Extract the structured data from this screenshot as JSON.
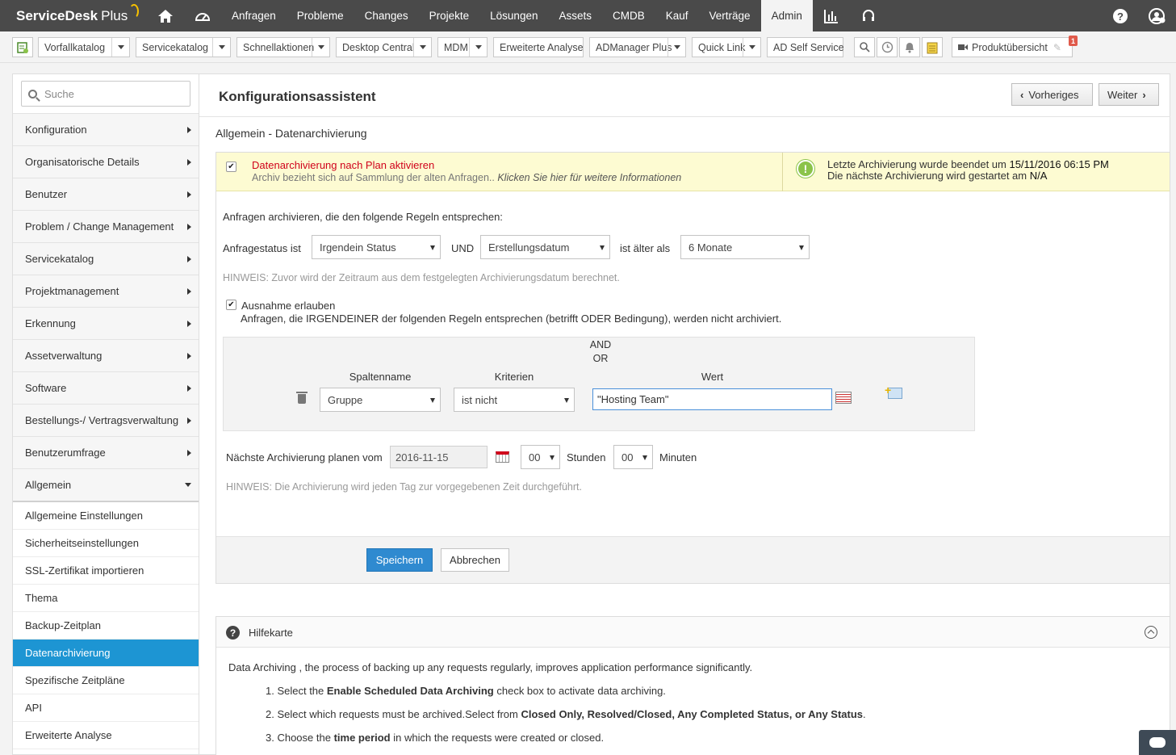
{
  "app": {
    "name": "ServiceDesk",
    "plus": "Plus"
  },
  "nav": {
    "items": [
      "Anfragen",
      "Probleme",
      "Changes",
      "Projekte",
      "Lösungen",
      "Assets",
      "CMDB",
      "Kauf",
      "Verträge",
      "Admin"
    ],
    "active": "Admin"
  },
  "toolbar": {
    "items": [
      "Vorfallkatalog",
      "Servicekatalog",
      "Schnellaktionen",
      "Desktop Central",
      "MDM",
      "Erweiterte Analyse",
      "ADManager Plus",
      "Quick Link",
      "AD Self Service"
    ],
    "product_overview": "Produktübersicht",
    "badge_count": "1"
  },
  "sidebar": {
    "search_placeholder": "Suche",
    "menu": [
      "Konfiguration",
      "Organisatorische Details",
      "Benutzer",
      "Problem / Change Management",
      "Servicekatalog",
      "Projektmanagement",
      "Erkennung",
      "Assetverwaltung",
      "Software",
      "Bestellungs-/ Vertragsverwaltung",
      "Benutzerumfrage",
      "Allgemein"
    ],
    "submenu": [
      "Allgemeine Einstellungen",
      "Sicherheitseinstellungen",
      "SSL-Zertifikat importieren",
      "Thema",
      "Backup-Zeitplan",
      "Datenarchivierung",
      "Spezifische Zeitpläne",
      "API",
      "Erweiterte Analyse"
    ],
    "active_sub": "Datenarchivierung"
  },
  "main": {
    "title": "Konfigurationsassistent",
    "prev_label": "Vorheriges",
    "next_label": "Weiter",
    "section_title": "Allgemein - Datenarchivierung",
    "enable_label": "Datenarchivierung nach Plan aktivieren",
    "enable_sub": "Archiv bezieht sich auf Sammlung der alten Anfragen.. ",
    "enable_sub_link": "Klicken Sie hier für weitere Informationen",
    "last_archive_prefix": "Letzte Archivierung wurde beendet um ",
    "last_archive_value": "15/11/2016 06:15 PM",
    "next_archive_prefix": "Die nächste Archivierung wird gestartet am ",
    "next_archive_value": "N/A",
    "rules_intro": "Anfragen archivieren, die den folgende Regeln entsprechen:",
    "status_label": "Anfragestatus ist",
    "status_value": "Irgendein Status",
    "und_label": "UND",
    "date_field_value": "Erstellungsdatum",
    "older_label": "ist älter als",
    "age_value": "6 Monate",
    "note1": "HINWEIS: Zuvor wird der Zeitraum aus dem festgelegten Archivierungsdatum berechnet.",
    "exception_label": "Ausnahme erlauben",
    "exception_sub": "Anfragen, die IRGENDEINER der folgenden Regeln entsprechen (betrifft ODER Bedingung), werden nicht archiviert.",
    "and_label": "AND",
    "or_label": "OR",
    "col_column": "Spaltenname",
    "col_criteria": "Kriterien",
    "col_value": "Wert",
    "rule_column": "Gruppe",
    "rule_criteria": "ist nicht",
    "rule_value": "\"Hosting Team\"",
    "schedule_label": "Nächste Archivierung planen vom",
    "schedule_date": "2016-11-15",
    "hours_value": "00",
    "hours_label": "Stunden",
    "minutes_value": "00",
    "minutes_label": "Minuten",
    "note2": "HINWEIS: Die Archivierung wird jeden Tag zur vorgegebenen Zeit durchgeführt.",
    "save_label": "Speichern",
    "cancel_label": "Abbrechen"
  },
  "help": {
    "title": "Hilfekarte",
    "intro_bold": "Data Archiving",
    "intro_rest": " , the process of backing up any requests regularly, improves application performance significantly.",
    "step1_a": "1. Select the ",
    "step1_b": "Enable Scheduled Data Archiving",
    "step1_c": " check box to activate data archiving.",
    "step2_a": "2. Select which requests must be archived.Select from ",
    "step2_b": "Closed Only, Resolved/Closed, Any Completed Status, or Any Status",
    "step2_c": ".",
    "step3_a": "3. Choose the ",
    "step3_b": "time period",
    "step3_c": " in which the requests were created or closed."
  }
}
